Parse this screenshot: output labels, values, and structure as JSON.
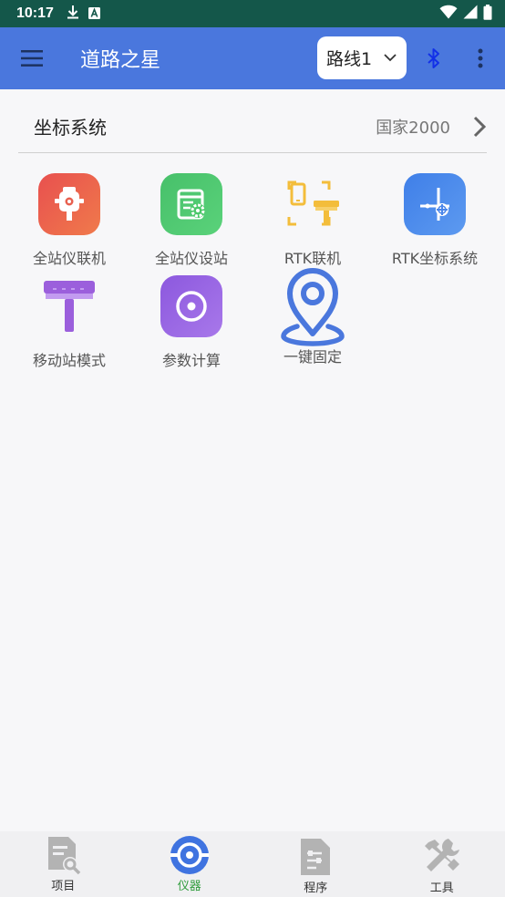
{
  "status_bar": {
    "time": "10:17"
  },
  "app_bar": {
    "title": "道路之星",
    "route_value": "路线1"
  },
  "coordinate_system": {
    "label": "坐标系统",
    "value": "国家2000"
  },
  "functions": [
    {
      "label": "全站仪联机",
      "icon": "total-station-connect-icon",
      "color": "#e8604f"
    },
    {
      "label": "全站仪设站",
      "icon": "total-station-setup-icon",
      "color": "#4cc86a"
    },
    {
      "label": "RTK联机",
      "icon": "rtk-connect-icon",
      "color": "#f3bd3b"
    },
    {
      "label": "RTK坐标系统",
      "icon": "rtk-coordinate-icon",
      "color": "#4a86ea"
    },
    {
      "label": "移动站模式",
      "icon": "rover-mode-icon",
      "color": "#a05cdc"
    },
    {
      "label": "参数计算",
      "icon": "parameter-calc-icon",
      "color": "#8f5ee0"
    },
    {
      "label": "一键固定",
      "icon": "one-key-fix-icon",
      "color": "#4a77dd"
    }
  ],
  "bottom_nav": [
    {
      "label": "项目",
      "icon": "project-icon",
      "active": false
    },
    {
      "label": "仪器",
      "icon": "instrument-icon",
      "active": true
    },
    {
      "label": "程序",
      "icon": "program-icon",
      "active": false
    },
    {
      "label": "工具",
      "icon": "tools-icon",
      "active": false
    }
  ]
}
